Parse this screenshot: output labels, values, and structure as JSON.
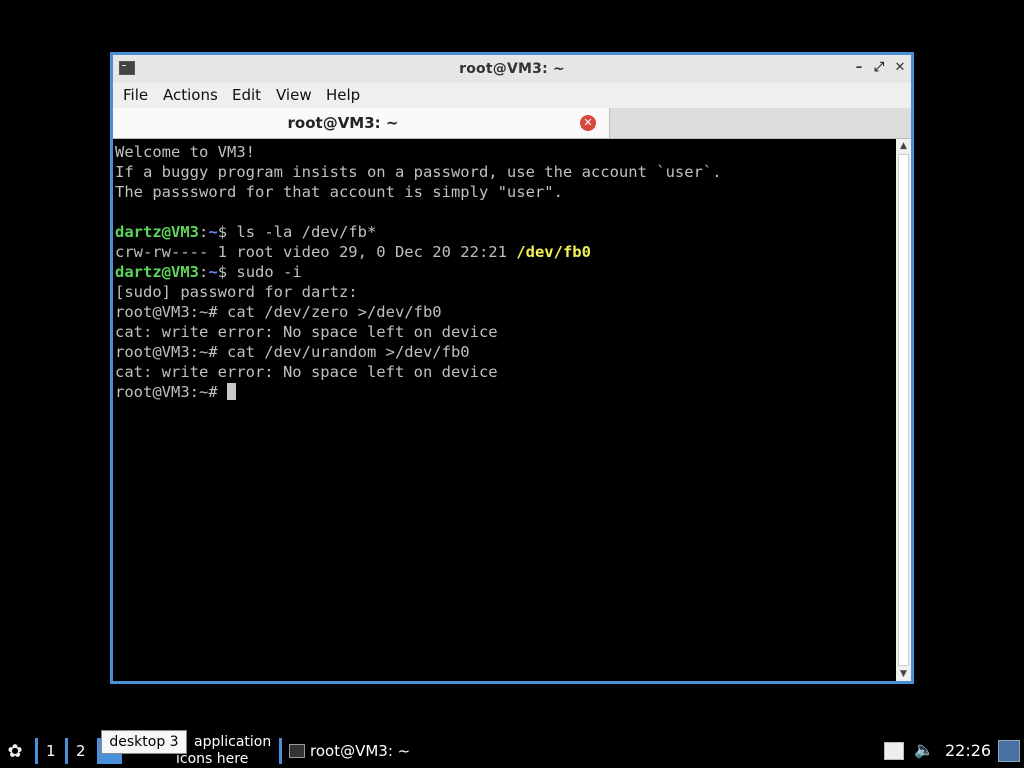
{
  "window": {
    "title": "root@VM3: ~",
    "controls": {
      "minimize": "–",
      "maximize": "⤢",
      "close": "✕"
    }
  },
  "menubar": {
    "items": [
      "File",
      "Actions",
      "Edit",
      "View",
      "Help"
    ]
  },
  "tab": {
    "label": "root@VM3: ~",
    "close": "✕"
  },
  "terminal": {
    "lines": [
      {
        "text": "Welcome to VM3!"
      },
      {
        "text": "If a buggy program insists on a password, use the account `user`."
      },
      {
        "text": "The passsword for that account is simply \"user\"."
      },
      {
        "text": ""
      },
      {
        "prompt_user": "dartz@VM3",
        "prompt_path": "~",
        "prompt_sym": "$ ",
        "cmd": "ls -la /dev/fb*"
      },
      {
        "text": "crw-rw---- 1 root video 29, 0 Dec 20 22:21 ",
        "highlight": "/dev/fb0"
      },
      {
        "prompt_user": "dartz@VM3",
        "prompt_path": "~",
        "prompt_sym": "$ ",
        "cmd": "sudo -i"
      },
      {
        "text": "[sudo] password for dartz:"
      },
      {
        "text": "root@VM3:~# cat /dev/zero >/dev/fb0"
      },
      {
        "text": "cat: write error: No space left on device"
      },
      {
        "text": "root@VM3:~# cat /dev/urandom >/dev/fb0"
      },
      {
        "text": "cat: write error: No space left on device"
      },
      {
        "text": "root@VM3:~# "
      }
    ]
  },
  "taskbar": {
    "desktops": [
      "1",
      "2"
    ],
    "tooltip": "desktop 3",
    "launch_hint_1": "application",
    "launch_hint_2": "icons here",
    "task_label": "root@VM3: ~",
    "clock": "22:26"
  },
  "colors": {
    "accent": "#4a90d9",
    "prompt_user": "#5dd55d",
    "prompt_path": "#6a8cff",
    "highlight": "#f2f25a"
  }
}
